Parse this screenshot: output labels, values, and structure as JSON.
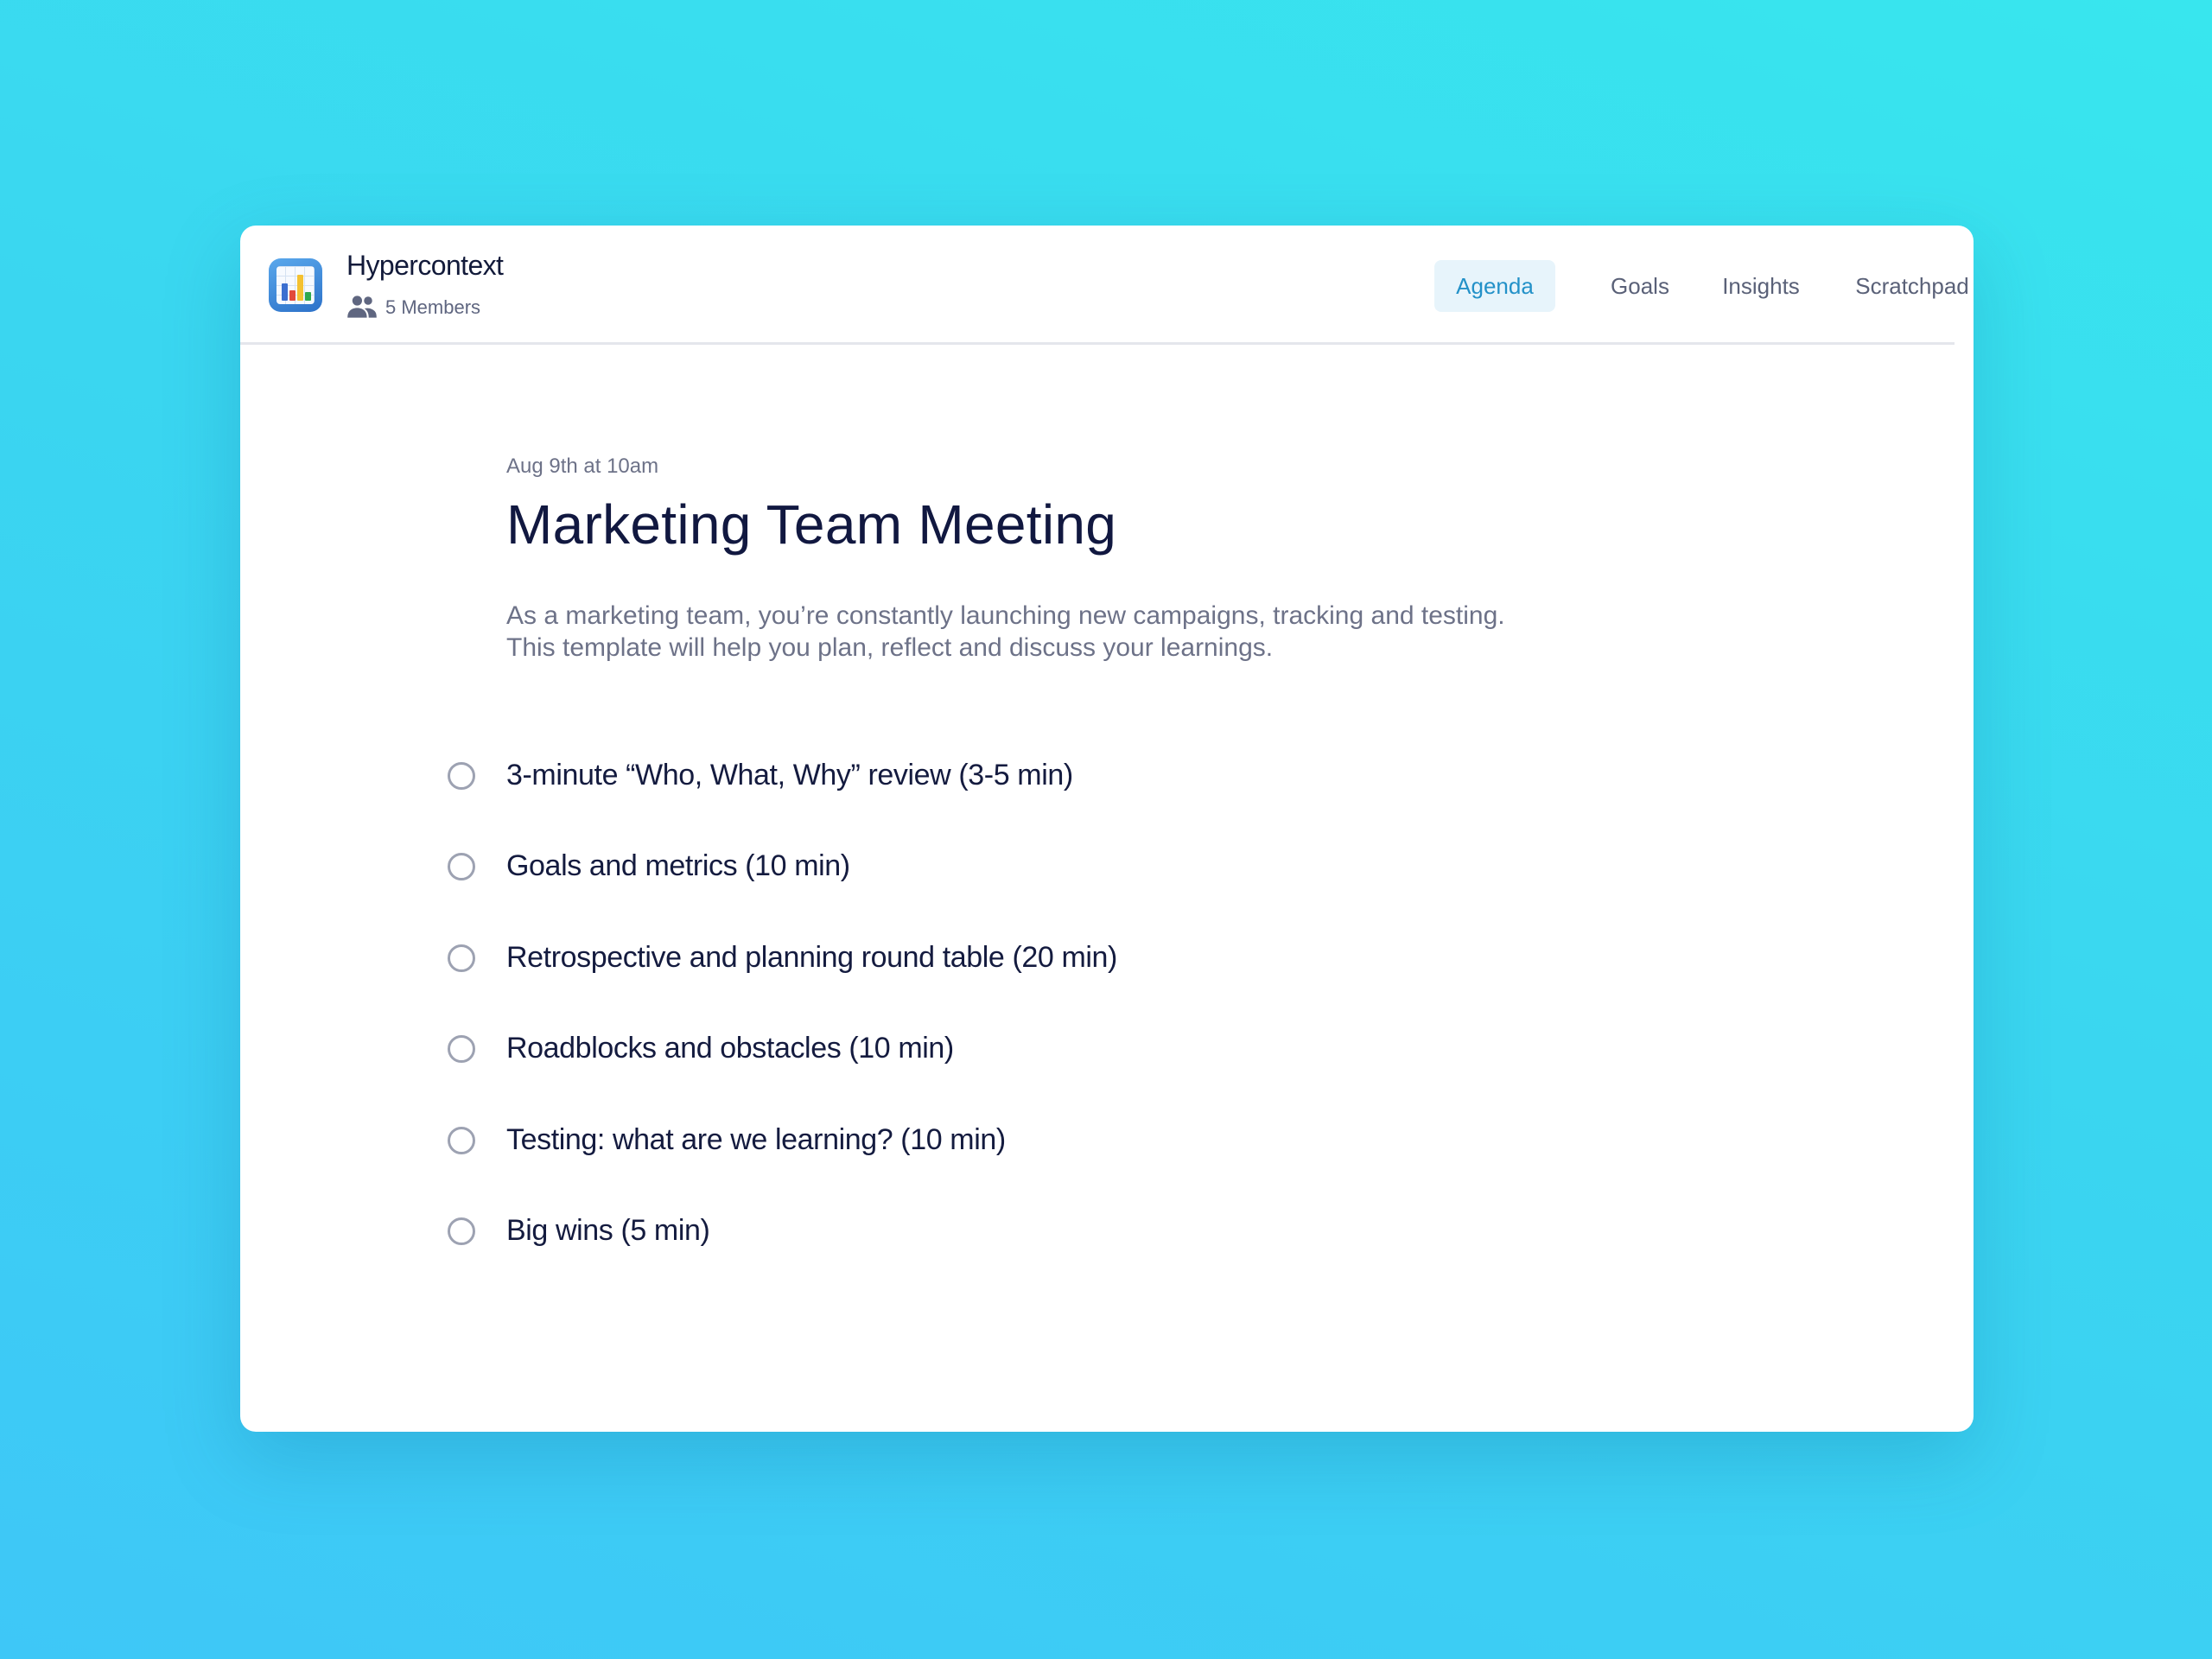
{
  "colors": {
    "accent": "#2391c8",
    "accent_bg": "#e7f4fb",
    "title": "#111840",
    "muted": "#6d7288",
    "background_gradient": [
      "#38e6ee",
      "#3ec7f7"
    ]
  },
  "header": {
    "app_name": "Hypercontext",
    "app_icon": "bar-chart-app-icon",
    "members_icon": "people-icon",
    "members_label": "5 Members",
    "tabs": [
      {
        "label": "Agenda",
        "active": true
      },
      {
        "label": "Goals",
        "active": false
      },
      {
        "label": "Insights",
        "active": false
      },
      {
        "label": "Scratchpad",
        "active": false
      }
    ],
    "actions": [
      {
        "icon": "add-person-icon"
      },
      {
        "icon": "more-horizontal-icon"
      }
    ]
  },
  "meeting": {
    "date": "Aug 9th at 10am",
    "title": "Marketing Team Meeting",
    "description_lines": [
      "As a marketing team, you’re constantly launching new campaigns, tracking and testing.",
      "This template will help you plan, reflect and discuss your learnings."
    ]
  },
  "agenda": [
    {
      "label": "3-minute “Who, What, Why” review (3-5 min)",
      "done": false
    },
    {
      "label": "Goals and metrics (10 min)",
      "done": false
    },
    {
      "label": "Retrospective and planning round table (20 min)",
      "done": false
    },
    {
      "label": "Roadblocks and obstacles (10 min)",
      "done": false
    },
    {
      "label": "Testing: what are we learning? (10 min)",
      "done": false
    },
    {
      "label": "Big wins (5 min)",
      "done": false
    }
  ]
}
